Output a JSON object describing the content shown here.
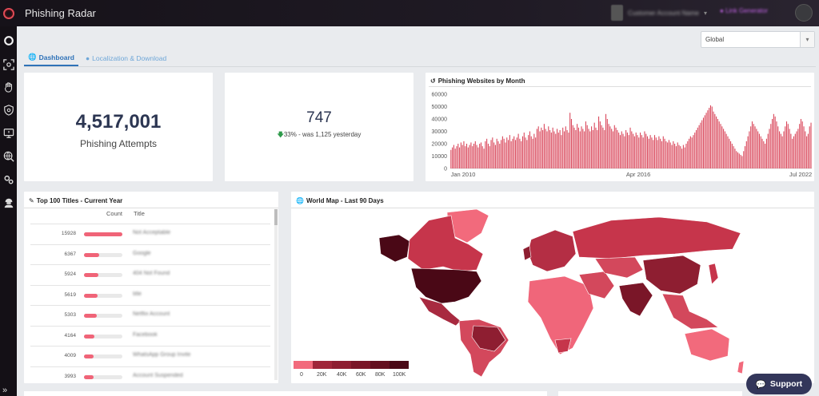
{
  "app": {
    "title": "Phishing Radar"
  },
  "topbar": {
    "user_name": "Customer Account Name",
    "link_label": "Link Generator"
  },
  "region": {
    "selected": "Global"
  },
  "tabs": [
    {
      "label": "Dashboard",
      "icon": "globe-icon",
      "active": true
    },
    {
      "label": "Localization & Download",
      "icon": "pin-icon",
      "active": false
    }
  ],
  "stats": {
    "attempts_value": "4,517,001",
    "attempts_label": "Phishing Attempts",
    "today_value": "747",
    "today_trend_pct": "33%",
    "today_trend_text": " - was 1,125 yesterday"
  },
  "monthly_chart": {
    "title": "Phishing Websites by Month",
    "icon": "history-icon"
  },
  "top_titles": {
    "title": "Top 100 Titles - Current Year",
    "icon": "pin-icon",
    "col_count": "Count",
    "col_title": "Title",
    "max": 15928,
    "rows": [
      {
        "count": "15928",
        "value": 15928,
        "title": "Not Acceptable"
      },
      {
        "count": "6367",
        "value": 6367,
        "title": "Google"
      },
      {
        "count": "5924",
        "value": 5924,
        "title": "404 Not Found"
      },
      {
        "count": "5619",
        "value": 5619,
        "title": "title"
      },
      {
        "count": "5303",
        "value": 5303,
        "title": "Netflix Account"
      },
      {
        "count": "4164",
        "value": 4164,
        "title": "Facebook"
      },
      {
        "count": "4009",
        "value": 4009,
        "title": "WhatsApp Group Invite"
      },
      {
        "count": "3993",
        "value": 3993,
        "title": "Account Suspended"
      }
    ]
  },
  "world_map": {
    "title": "World Map - Last 90 Days",
    "icon": "globe-icon",
    "legend_labels": [
      "0",
      "20K",
      "40K",
      "60K",
      "80K",
      "100K"
    ],
    "legend_colors": [
      "#f26a7c",
      "#a0263a",
      "#8e1e31",
      "#7a1628",
      "#640f1f",
      "#4a0816"
    ]
  },
  "support": {
    "label": "Support",
    "icon": "chat-icon"
  },
  "colors": {
    "accent": "#2f72b8",
    "red_series": "#d9465a",
    "green_series": "#3db96a",
    "sidebar": "#141016"
  },
  "chart_data": {
    "type": "bar",
    "title": "Phishing Websites by Month",
    "xlabel": "",
    "ylabel": "",
    "ylim": [
      0,
      60000
    ],
    "yticks": [
      "0",
      "10000",
      "20000",
      "30000",
      "40000",
      "50000",
      "60000"
    ],
    "xtick_labels": [
      "Jan 2010",
      "Apr 2016",
      "Jul 2022"
    ],
    "grid": false,
    "start_year": 2010,
    "start_month": 1,
    "series": [
      {
        "name": "",
        "color": "#d9465a",
        "values": [
          15000,
          17000,
          19000,
          16000,
          18000,
          20000,
          17000,
          21000,
          19000,
          22000,
          18000,
          20000,
          17000,
          19000,
          21000,
          18000,
          20000,
          22000,
          19000,
          17000,
          20000,
          21000,
          18000,
          16000,
          22000,
          24000,
          20000,
          18000,
          23000,
          25000,
          21000,
          19000,
          24000,
          22000,
          20000,
          23000,
          26000,
          24000,
          21000,
          25000,
          23000,
          27000,
          22000,
          24000,
          26000,
          23000,
          25000,
          28000,
          24000,
          22000,
          26000,
          29000,
          25000,
          23000,
          27000,
          30000,
          26000,
          24000,
          28000,
          25000,
          32000,
          34000,
          30000,
          33000,
          31000,
          36000,
          32000,
          30000,
          34000,
          31000,
          29000,
          33000,
          30000,
          28000,
          32000,
          29000,
          31000,
          27000,
          33000,
          30000,
          34000,
          31000,
          29000,
          45000,
          40000,
          35000,
          33000,
          31000,
          36000,
          33000,
          30000,
          34000,
          32000,
          30000,
          38000,
          35000,
          32000,
          30000,
          34000,
          31000,
          37000,
          33000,
          31000,
          42000,
          38000,
          35000,
          33000,
          31000,
          44000,
          40000,
          36000,
          34000,
          32000,
          30000,
          35000,
          33000,
          31000,
          29000,
          27000,
          30000,
          28000,
          26000,
          31000,
          29000,
          27000,
          33000,
          30000,
          28000,
          26000,
          29000,
          27000,
          25000,
          29000,
          27000,
          25000,
          30000,
          28000,
          26000,
          24000,
          27000,
          25000,
          23000,
          27000,
          25000,
          23000,
          26000,
          24000,
          22000,
          26000,
          24000,
          22000,
          21000,
          23000,
          21000,
          19000,
          22000,
          20000,
          18000,
          21000,
          19000,
          18000,
          16000,
          19000,
          17000,
          20000,
          22000,
          24000,
          26000,
          25000,
          27000,
          29000,
          31000,
          33000,
          35000,
          37000,
          39000,
          41000,
          43000,
          45000,
          47000,
          49000,
          51000,
          50000,
          46000,
          44000,
          42000,
          40000,
          38000,
          36000,
          34000,
          32000,
          30000,
          28000,
          26000,
          24000,
          22000,
          20000,
          18000,
          16000,
          14000,
          13000,
          12000,
          11000,
          10000,
          14000,
          18000,
          22000,
          26000,
          30000,
          34000,
          38000,
          36000,
          34000,
          32000,
          30000,
          28000,
          26000,
          24000,
          22000,
          20000,
          24000,
          28000,
          32000,
          36000,
          40000,
          44000,
          42000,
          38000,
          34000,
          30000,
          28000,
          26000,
          30000,
          34000,
          38000,
          36000,
          32000,
          28000,
          24000,
          26000,
          28000,
          30000,
          32000,
          36000,
          40000,
          38000,
          34000,
          30000,
          26000,
          28000,
          34000,
          37000
        ]
      },
      {
        "name": "",
        "color": "#3db96a",
        "values": [
          0,
          0,
          0,
          0,
          0,
          0,
          0,
          0,
          0,
          0,
          0,
          0,
          0,
          0,
          0,
          0,
          0,
          0,
          0,
          0,
          0,
          0,
          0,
          0,
          0,
          0,
          0,
          0,
          0,
          0,
          0,
          0,
          0,
          0,
          0,
          0,
          0,
          0,
          0,
          0,
          0,
          0,
          0,
          0,
          0,
          0,
          0,
          0,
          0,
          0,
          0,
          0,
          0,
          0,
          0,
          0,
          0,
          0,
          0,
          0,
          0,
          0,
          0,
          0,
          0,
          0,
          0,
          0,
          0,
          0,
          0,
          0,
          0,
          0,
          0,
          0,
          0,
          0,
          0,
          0,
          0,
          0,
          0,
          0,
          0,
          0,
          0,
          0,
          0,
          0,
          0,
          0,
          0,
          0,
          0,
          0,
          0,
          0,
          0,
          0,
          0,
          0,
          0,
          0,
          0,
          0,
          0,
          0,
          0,
          0,
          0,
          0,
          0,
          0,
          0,
          0,
          0,
          0,
          0,
          0,
          0,
          0,
          0,
          0,
          0,
          0,
          0,
          0,
          0,
          0,
          0,
          0,
          0,
          0,
          0,
          0,
          0,
          0,
          0,
          0,
          0,
          0,
          0,
          0,
          0,
          0,
          0,
          0,
          0,
          0,
          0,
          0,
          0,
          0,
          0,
          0,
          0,
          0,
          0,
          0,
          0,
          0,
          0,
          0,
          0,
          0,
          0,
          0,
          0,
          0,
          0,
          0,
          0,
          0,
          0,
          0,
          0,
          0,
          0,
          0,
          0,
          0,
          0,
          0,
          0,
          0,
          0,
          0,
          0,
          0,
          0,
          0,
          0,
          0,
          0,
          0,
          0,
          0,
          0,
          0,
          0,
          0,
          0,
          0,
          0,
          0,
          0,
          0,
          0,
          0,
          0,
          0,
          0,
          0,
          0,
          0,
          0,
          0,
          0,
          0,
          0,
          0,
          0,
          0,
          0,
          0,
          0,
          0,
          0,
          0,
          0,
          0,
          0,
          0,
          0,
          0,
          0,
          0,
          0,
          0,
          0,
          0,
          0,
          0,
          0,
          0,
          0,
          0,
          0,
          0,
          0,
          0,
          0,
          0,
          0,
          0,
          0,
          0,
          0,
          0,
          0,
          0,
          0,
          0,
          0,
          0,
          0,
          0,
          0,
          0,
          0,
          0
        ]
      }
    ]
  }
}
